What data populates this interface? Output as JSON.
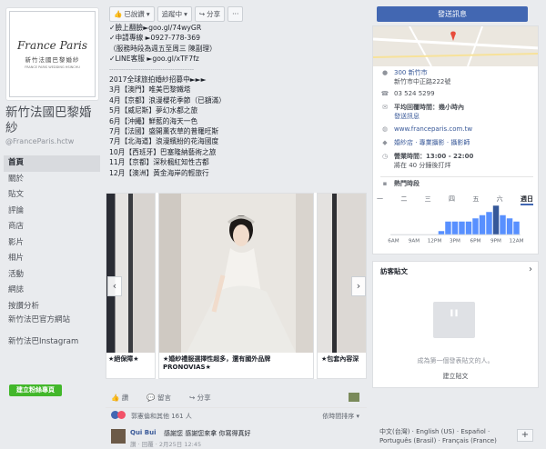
{
  "page": {
    "logo_main": "France Paris",
    "logo_cn": "新竹法國巴黎婚紗",
    "logo_sub": "FRANCE PARIS WEDDING HSINCHU",
    "name": "新竹法國巴黎婚紗",
    "handle": "@FranceParis.hctw"
  },
  "nav": [
    "首頁",
    "關於",
    "貼文",
    "評論",
    "商店",
    "影片",
    "相片",
    "活動",
    "網誌",
    "按讚分析",
    "新竹法巴官方網站",
    "新竹法巴Instagram"
  ],
  "create_label": "建立粉絲專頁",
  "toolbar": {
    "liked": "已說讚",
    "following": "追蹤中",
    "share": "分享",
    "more": "···"
  },
  "post_lines": [
    "✓臉上翻臉►goo.gl/74wyGR",
    "✓申請專線 ►0927-778-369",
    "（服務時段為週五至周三 陳副理）",
    "✓LINE客服 ►goo.gl/xTF7fz",
    "-------------------------------------------",
    "2017全球旅拍婚紗招募中►►►",
    "3月【澳門】唯美巴黎鐵塔",
    "4月【京都】浪漫櫻花季節（已額滿）",
    "5月【威尼斯】夢幻水都之旅",
    "6月【沖繩】鮮藍的海天一色",
    "7月【法國】盛開薰衣草的普羅旺斯",
    "7月【北海道】浪漫繽紛的花海國度",
    "10月【西班牙】巴塞隆納藝術之旅",
    "11月【京都】深秋楓紅知性古都",
    "12月【澳洲】黃金海岸的輕旅行"
  ],
  "cards": [
    {
      "caption": "★絕保障★"
    },
    {
      "caption": "★婚紗禮服選擇性超多，還有國外品牌PRONOVIAS★"
    },
    {
      "caption": "★包套內容深"
    }
  ],
  "actions": {
    "like": "讚",
    "comment": "留言",
    "share": "分享"
  },
  "reactions": {
    "text": "郭憲倫和其他 161 人",
    "sort": "依時間排序 ▾"
  },
  "comment": {
    "author": "Qui Bui",
    "text": "感謝您 感謝您來拿 你寫得真好",
    "meta": "讚 · 回覆 · 2月25日 12:45"
  },
  "right": {
    "message_btn": "發送訊息",
    "address1": "300 新竹市",
    "address2": "新竹市中正路222號",
    "phone": "03 524 5299",
    "response": "平均回覆時間：幾小時內",
    "send_msg": "發送訊息",
    "website": "www.franceparis.com.tw",
    "category": "婚紗店 · 專業攝影 · 攝影師",
    "hours": "營業時間：13:00 - 22:00",
    "hours_sub": "將在 40 分鐘後打烊",
    "popular": "熱門時段",
    "days": [
      "一",
      "二",
      "三",
      "四",
      "五",
      "六",
      "週日"
    ],
    "visitor_title": "訪客貼文",
    "visitor_empty": "成為第一個發表貼文的人。",
    "visitor_btn": "建立貼文",
    "languages": "中文(台灣) · English (US) · Español · Português (Brasil) · Français (France)"
  },
  "chart_data": {
    "type": "bar",
    "categories": [
      "6AM",
      "7AM",
      "8AM",
      "9AM",
      "10AM",
      "11AM",
      "12PM",
      "1PM",
      "2PM",
      "3PM",
      "4PM",
      "5PM",
      "6PM",
      "7PM",
      "8PM",
      "9PM",
      "10PM",
      "11PM",
      "12AM"
    ],
    "values": [
      0,
      0,
      0,
      0,
      0,
      0,
      0,
      1,
      4,
      4,
      4,
      4,
      5,
      6,
      7,
      9,
      6,
      5,
      4
    ],
    "xlabel": "",
    "ylabel": "",
    "tick_labels": [
      "6AM",
      "9AM",
      "12PM",
      "3PM",
      "6PM",
      "9PM",
      "12AM"
    ]
  }
}
